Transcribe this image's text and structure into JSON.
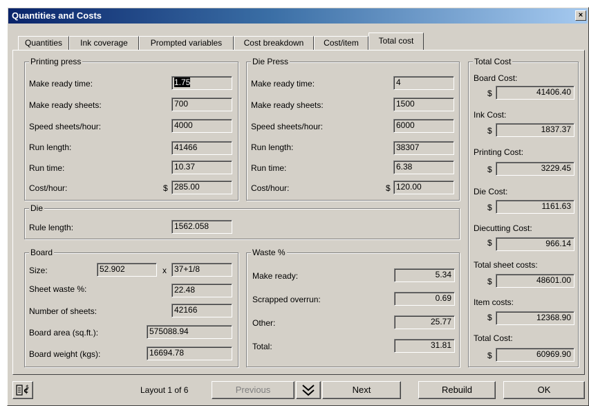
{
  "window": {
    "title": "Quantities and Costs",
    "close": "×"
  },
  "tabs": [
    "Quantities",
    "Ink coverage",
    "Prompted variables",
    "Cost breakdown",
    "Cost/item",
    "Total cost"
  ],
  "printing_press": {
    "title": "Printing press",
    "make_ready_time": {
      "label": "Make ready time:",
      "value": "1.75"
    },
    "make_ready_sheets": {
      "label": "Make ready sheets:",
      "value": "700"
    },
    "speed": {
      "label": "Speed sheets/hour:",
      "value": "4000"
    },
    "run_length": {
      "label": "Run length:",
      "value": "41466"
    },
    "run_time": {
      "label": "Run time:",
      "value": "10.37"
    },
    "cost_hour": {
      "label": "Cost/hour:",
      "currency": "$",
      "value": "285.00"
    }
  },
  "die_press": {
    "title": "Die Press",
    "make_ready_time": {
      "label": "Make ready time:",
      "value": "4"
    },
    "make_ready_sheets": {
      "label": "Make ready sheets:",
      "value": "1500"
    },
    "speed": {
      "label": "Speed sheets/hour:",
      "value": "6000"
    },
    "run_length": {
      "label": "Run length:",
      "value": "38307"
    },
    "run_time": {
      "label": "Run time:",
      "value": "6.38"
    },
    "cost_hour": {
      "label": "Cost/hour:",
      "currency": "$",
      "value": "120.00"
    }
  },
  "die": {
    "title": "Die",
    "rule_length": {
      "label": "Rule length:",
      "value": "1562.058"
    }
  },
  "board": {
    "title": "Board",
    "size": {
      "label": "Size:",
      "width": "52.902",
      "x": "x",
      "height": "37+1/8"
    },
    "sheet_waste": {
      "label": "Sheet waste %:",
      "value": "22.48"
    },
    "number_of_sheets": {
      "label": "Number of sheets:",
      "value": "42166"
    },
    "board_area": {
      "label": "Board area (sq.ft.):",
      "value": "575088.94"
    },
    "board_weight": {
      "label": "Board weight (kgs):",
      "value": "16694.78"
    }
  },
  "waste": {
    "title": "Waste %",
    "make_ready": {
      "label": "Make ready:",
      "value": "5.34"
    },
    "scrapped_overrun": {
      "label": "Scrapped overrun:",
      "value": "0.69"
    },
    "other": {
      "label": "Other:",
      "value": "25.77"
    },
    "total": {
      "label": "Total:",
      "value": "31.81"
    }
  },
  "total_cost": {
    "title": "Total Cost",
    "currency": "$",
    "items": [
      {
        "label": "Board Cost:",
        "value": "41406.40"
      },
      {
        "label": "Ink Cost:",
        "value": "1837.37"
      },
      {
        "label": "Printing Cost:",
        "value": "3229.45"
      },
      {
        "label": "Die Cost:",
        "value": "1161.63"
      },
      {
        "label": "Diecutting Cost:",
        "value": "966.14"
      },
      {
        "label": "Total sheet costs:",
        "value": "48601.00"
      },
      {
        "label": "Item costs:",
        "value": "12368.90"
      },
      {
        "label": "Total Cost:",
        "value": "60969.90"
      }
    ]
  },
  "footer": {
    "layout_text": "Layout 1 of 6",
    "previous": "Previous",
    "next": "Next",
    "rebuild": "Rebuild",
    "ok": "OK"
  }
}
